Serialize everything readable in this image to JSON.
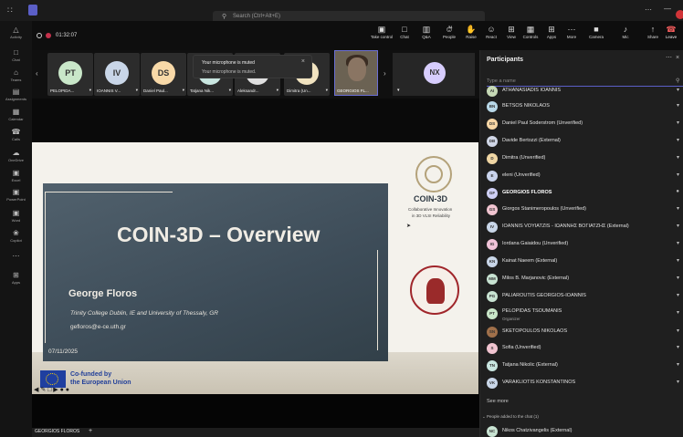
{
  "titlebar": {
    "search_placeholder": "Search (Ctrl+Alt+E)"
  },
  "rail": [
    {
      "label": "Activity",
      "icon": "bell-icon",
      "glyph": "△"
    },
    {
      "label": "Chat",
      "icon": "chat-icon",
      "glyph": "□"
    },
    {
      "label": "Teams",
      "icon": "teams-icon",
      "glyph": "⌂"
    },
    {
      "label": "Assignments",
      "icon": "assignments-icon",
      "glyph": "▤"
    },
    {
      "label": "Calendar",
      "icon": "calendar-icon",
      "glyph": "▦"
    },
    {
      "label": "Calls",
      "icon": "phone-icon",
      "glyph": "☎"
    },
    {
      "label": "OneDrive",
      "icon": "cloud-icon",
      "glyph": "☁"
    },
    {
      "label": "Excel",
      "icon": "excel-icon",
      "glyph": "▣"
    },
    {
      "label": "PowerPoint",
      "icon": "powerpoint-icon",
      "glyph": "▣"
    },
    {
      "label": "Word",
      "icon": "word-icon",
      "glyph": "▣"
    },
    {
      "label": "Copilot",
      "icon": "copilot-icon",
      "glyph": "❀"
    },
    {
      "label": "",
      "icon": "more-icon",
      "glyph": "⋯"
    },
    {
      "label": "Apps",
      "icon": "apps-icon",
      "glyph": "⊞"
    }
  ],
  "meeting": {
    "timer": "01:32:07",
    "controls": [
      {
        "label": "Take control",
        "icon": "take-control-icon",
        "glyph": "▣"
      },
      {
        "label": "Chat",
        "icon": "chat-icon",
        "glyph": "□"
      },
      {
        "label": "Q&A",
        "icon": "qa-icon",
        "glyph": "▥"
      },
      {
        "label": "People",
        "icon": "people-icon",
        "glyph": "☺"
      },
      {
        "label": "Raise",
        "icon": "hand-icon",
        "glyph": "✋"
      },
      {
        "label": "React",
        "icon": "react-icon",
        "glyph": "☺"
      },
      {
        "label": "View",
        "icon": "view-icon",
        "glyph": "⊞"
      },
      {
        "label": "Controls",
        "icon": "controls-icon",
        "glyph": "▦"
      },
      {
        "label": "Apps",
        "icon": "apps-icon",
        "glyph": "⊞"
      },
      {
        "label": "More",
        "icon": "more-icon",
        "glyph": "⋯"
      },
      {
        "label": "Camera",
        "icon": "camera-icon",
        "glyph": "■"
      },
      {
        "label": "Mic",
        "icon": "mic-icon",
        "glyph": "♪"
      },
      {
        "label": "Share",
        "icon": "share-icon",
        "glyph": "↑"
      }
    ],
    "people_count": "34",
    "leave_label": "Leave"
  },
  "strip": {
    "tiles": [
      {
        "initials": "PT",
        "name": "PELOPIDA...",
        "color": "#c9e7c9"
      },
      {
        "initials": "IV",
        "name": "IOANNIS V...",
        "color": "#c9d6e8"
      },
      {
        "initials": "DS",
        "name": "Daniel Paul...",
        "color": "#f8d9a8"
      },
      {
        "initials": "",
        "name": "Tatjana Nik...",
        "color": "#c9e6e0"
      },
      {
        "initials": "",
        "name": "Aleksandr...",
        "color": "#e0e0e0"
      },
      {
        "initials": "",
        "name": "Dimitra (Un...",
        "color": "#f1e3c0"
      }
    ],
    "video_name": "GEORGIOS FL...",
    "nx_initials": "NX",
    "toast_title": "Your microphone is muted",
    "toast_body": "Your microphone is muted."
  },
  "slide": {
    "title": "COIN-3D – Overview",
    "presenter": "George Floros",
    "affiliation": "Trinity College Dublin, IE and University of Thessaly, GR",
    "email": "gefloros@e-ce.uth.gr",
    "date": "07/11/2025",
    "coin_name": "COIN-3D",
    "coin_sub1": "Collaborative Innovation",
    "coin_sub2": "in 3D VLSI Reliability",
    "eu_line1": "Co-funded by",
    "eu_line2": "the European Union"
  },
  "bottom": {
    "presenter_chip": "GEORGIOS FLOROS",
    "plus": "+"
  },
  "panel": {
    "title": "Participants",
    "search_placeholder": "Type a name",
    "participants": [
      {
        "initials": "AI",
        "name": "ATHANASIADIS IOANNIS",
        "color": "#c6d9b6",
        "bold": false,
        "sub": ""
      },
      {
        "initials": "BN",
        "name": "BETSOS NIKOLAOS",
        "color": "#b8d8e8",
        "bold": false,
        "sub": ""
      },
      {
        "initials": "DS",
        "name": "Daniel Paul Soderstrom (Unverified)",
        "color": "#f8d7a6",
        "bold": false,
        "sub": ""
      },
      {
        "initials": "DB",
        "name": "Davide Bertozzi (External)",
        "color": "#d0d6e6",
        "bold": false,
        "sub": ""
      },
      {
        "initials": "D",
        "name": "Dimitra (Unverified)",
        "color": "#f0d6a4",
        "bold": false,
        "sub": ""
      },
      {
        "initials": "E",
        "name": "eleni (Unverified)",
        "color": "#c9d3ec",
        "bold": false,
        "sub": ""
      },
      {
        "initials": "GF",
        "name": "GEORGIOS FLOROS",
        "color": "#cfd0f5",
        "bold": true,
        "sub": ""
      },
      {
        "initials": "GS",
        "name": "Giorgos Stanimeropoulos (Unverified)",
        "color": "#f1c4d0",
        "bold": false,
        "sub": ""
      },
      {
        "initials": "IV",
        "name": "IOANNIS VOYIATZIS - ΙΩΑΝΝΗΣ ΒΟΓΙΑΤΖΗΣ (External)",
        "color": "#c9d6e8",
        "bold": false,
        "sub": ""
      },
      {
        "initials": "IG",
        "name": "Iordana Gaiaidou (Unverified)",
        "color": "#f1c4d9",
        "bold": false,
        "sub": ""
      },
      {
        "initials": "KN",
        "name": "Kainat Naeem (External)",
        "color": "#c9d6e8",
        "bold": false,
        "sub": ""
      },
      {
        "initials": "MM",
        "name": "Milos B. Marjanovic (External)",
        "color": "#c8e3d2",
        "bold": false,
        "sub": ""
      },
      {
        "initials": "PG",
        "name": "PALIAROUTIS GEORGIOS-IOANNIS",
        "color": "#c8e3d2",
        "bold": false,
        "sub": ""
      },
      {
        "initials": "PT",
        "name": "PELOPIDAS TSOUMANIS",
        "color": "#c9e7c9",
        "bold": false,
        "sub": "Organizer"
      },
      {
        "initials": "SN",
        "name": "SKETOPOULOS NIKOLAOS",
        "color": "#a0704a",
        "bold": false,
        "sub": ""
      },
      {
        "initials": "S",
        "name": "Sofia (Unverified)",
        "color": "#f1c4d0",
        "bold": false,
        "sub": ""
      },
      {
        "initials": "TN",
        "name": "Tatjana Nikolic (External)",
        "color": "#c9e6e0",
        "bold": false,
        "sub": ""
      },
      {
        "initials": "VK",
        "name": "VARAKLIOTIS KONSTANTINOS",
        "color": "#c9d6e8",
        "bold": false,
        "sub": ""
      }
    ],
    "see_more": "See more",
    "added_header": "People added to the chat (1)",
    "added": {
      "initials": "NC",
      "name": "Nikos Chatzivangelis (External)",
      "color": "#c8e3d2"
    }
  }
}
